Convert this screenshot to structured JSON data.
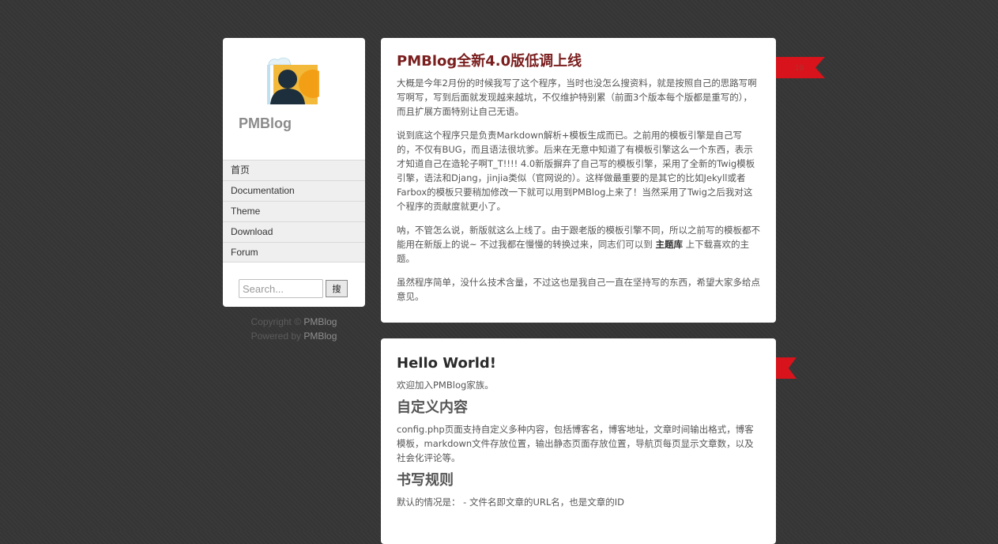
{
  "sidebar": {
    "site_title": "PMBlog",
    "nav": [
      {
        "label": "首页"
      },
      {
        "label": "Documentation"
      },
      {
        "label": "Theme"
      },
      {
        "label": "Download"
      },
      {
        "label": "Forum"
      }
    ],
    "search": {
      "placeholder": "Search...",
      "button_label": "搜"
    }
  },
  "footer": {
    "copyright_prefix": "Copyright ©",
    "copyright_brand": "PMBlog",
    "powered_prefix": "Powered by",
    "powered_brand": "PMBlog"
  },
  "posts": [
    {
      "title": "PMBlog全新4.0版低调上线",
      "comment_count": "19",
      "paragraphs": [
        "大概是今年2月份的时候我写了这个程序，当时也没怎么搜资料，就是按照自己的思路写啊写啊写，写到后面就发现越来越坑，不仅维护特别累（前面3个版本每个版都是重写的），而且扩展方面特别让自己无语。",
        "说到底这个程序只是负责Markdown解析+模板生成而已。之前用的模板引擎是自己写的，不仅有BUG，而且语法很坑爹。后来在无意中知道了有模板引擎这么一个东西，表示才知道自己在造轮子啊T_T!!!! 4.0新版摒弃了自己写的模板引擎，采用了全新的Twig模板引擎，语法和Djang，jinjia类似（官网说的）。这样做最重要的是其它的比如Jekyll或者Farbox的模板只要稍加修改一下就可以用到PMBlog上来了！当然采用了Twig之后我对这个程序的贡献度就更小了。"
      ],
      "paragraph3_before": "呐，不管怎么说，新版就这么上线了。由于跟老版的模板引擎不同，所以之前写的模板都不能用在新版上的说~ 不过我都在慢慢的转换过来，同志们可以到",
      "paragraph3_link": "主题库",
      "paragraph3_after": "上下载喜欢的主题。",
      "paragraph4": "虽然程序简单，没什么技术含量，不过这也是我自己一直在坚持写的东西，希望大家多给点意见。"
    },
    {
      "title": "Hello World!",
      "intro": "欢迎加入PMBlog家族。",
      "section1_heading": "自定义内容",
      "section1_text": "config.php页面支持自定义多种内容，包括博客名，博客地址，文章时间输出格式，博客模板，markdown文件存放位置，输出静态页面存放位置，导航页每页显示文章数，以及社会化评论等。",
      "section2_heading": "书写规则",
      "section2_text": "默认的情况是： - 文件名即文章的URL名，也是文章的ID"
    }
  ],
  "colors": {
    "background": "#363636",
    "ribbon": "#d8131b",
    "post_title": "#7a1e1e"
  }
}
